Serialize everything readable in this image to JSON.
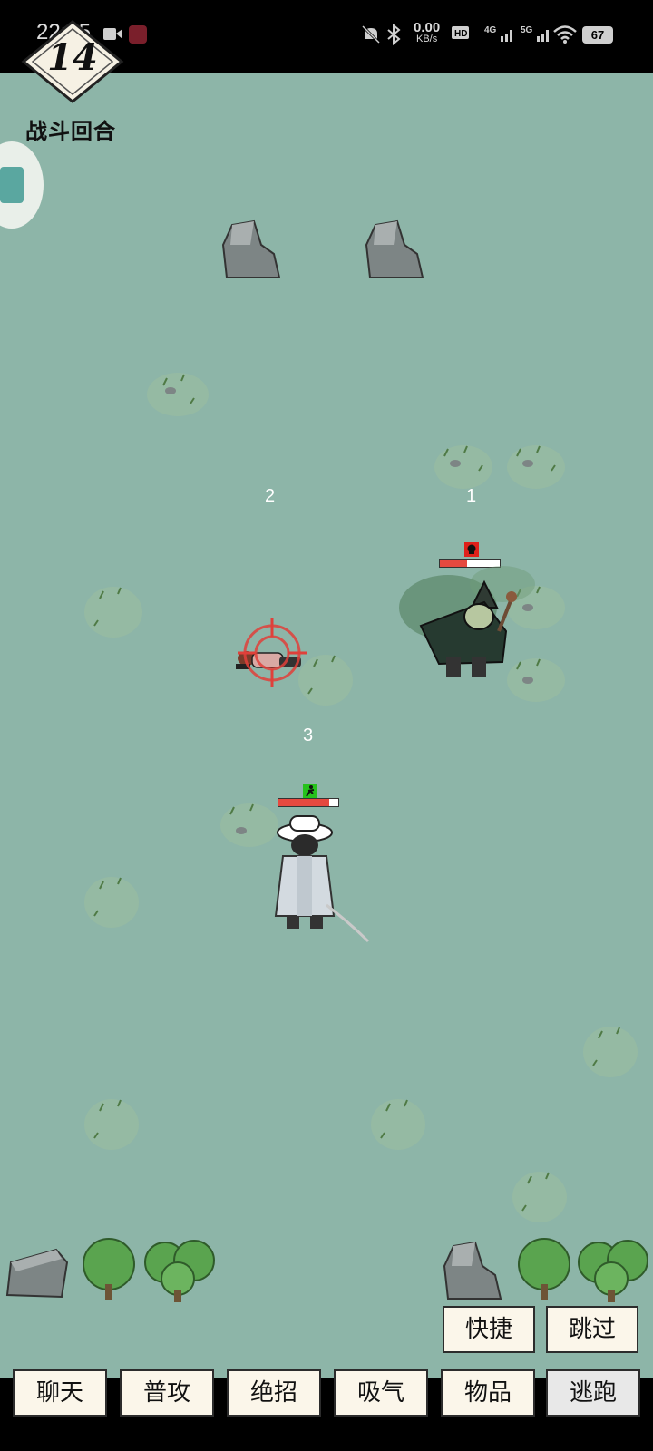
{
  "status_bar": {
    "time": "22:15",
    "net_speed_value": "0.00",
    "net_speed_unit": "KB/s",
    "battery": "67"
  },
  "battle": {
    "round_number": "14",
    "round_label": "战斗回合"
  },
  "field_markers": {
    "marker_1": "1",
    "marker_2": "2",
    "marker_3": "3"
  },
  "units": {
    "enemy": {
      "hp_fraction": 0.45,
      "status_color": "#e0201a"
    },
    "player": {
      "hp_fraction": 0.85,
      "status_color": "#26c21c"
    }
  },
  "actions": {
    "quick": "快捷",
    "skip": "跳过",
    "chat": "聊天",
    "normal_attack": "普攻",
    "ultimate": "绝招",
    "inhale": "吸气",
    "items": "物品",
    "flee": "逃跑"
  },
  "colors": {
    "field": "#8db5a8",
    "button_bg": "#fbf6ea",
    "target_reticle": "#e0403a"
  },
  "icons": [
    "mute-icon",
    "bluetooth-icon",
    "hd-icon",
    "signal-4g-icon",
    "signal-5g-icon",
    "wifi-icon",
    "battery-icon",
    "record-icon",
    "crosshair-icon",
    "skull-icon",
    "run-icon"
  ]
}
